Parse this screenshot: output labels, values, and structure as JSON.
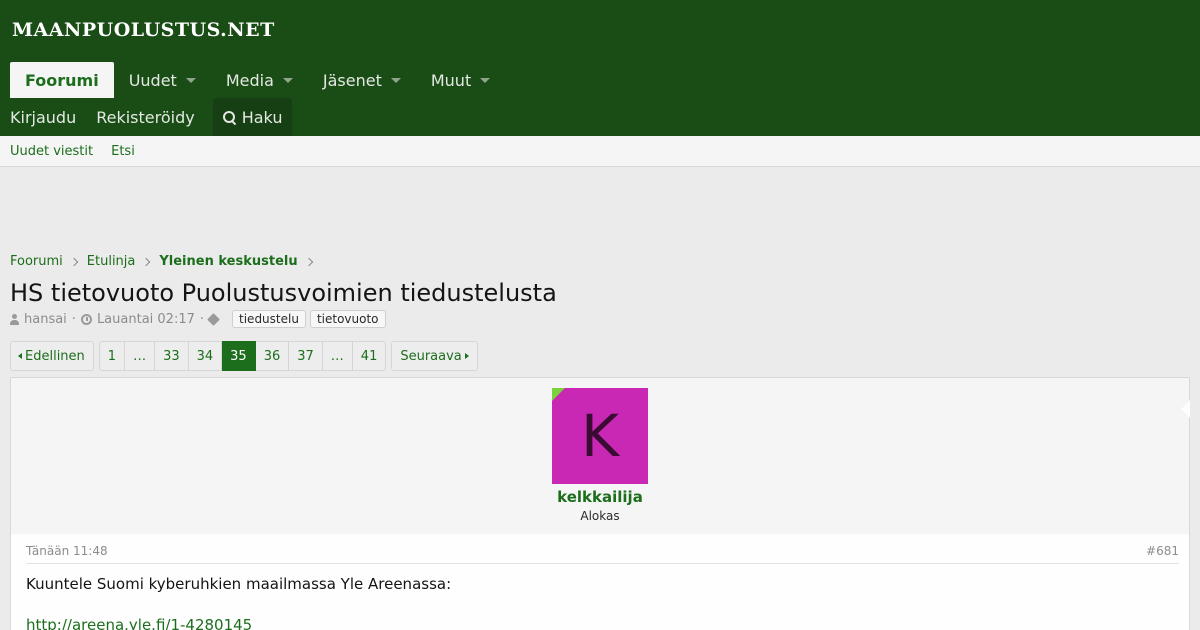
{
  "site": {
    "logo": "MAANPUOLUSTUS.NET"
  },
  "nav": {
    "items": [
      {
        "label": "Foorumi",
        "active": true
      },
      {
        "label": "Uudet",
        "dropdown": true
      },
      {
        "label": "Media",
        "dropdown": true
      },
      {
        "label": "Jäsenet",
        "dropdown": true
      },
      {
        "label": "Muut",
        "dropdown": true
      }
    ]
  },
  "userbar": {
    "login": "Kirjaudu",
    "register": "Rekisteröidy",
    "search": "Haku"
  },
  "subnav": {
    "new_posts": "Uudet viestit",
    "find": "Etsi"
  },
  "breadcrumb": {
    "items": [
      "Foorumi",
      "Etulinja",
      "Yleinen keskustelu"
    ]
  },
  "thread": {
    "title": "HS tietovuoto Puolustusvoimien tiedustelusta",
    "author": "hansai",
    "date": "Lauantai 02:17",
    "tags": [
      "tiedustelu",
      "tietovuoto"
    ]
  },
  "pagination": {
    "prev": "Edellinen",
    "next": "Seuraava",
    "pages": [
      "1",
      "…",
      "33",
      "34",
      "35",
      "36",
      "37",
      "…",
      "41"
    ],
    "current": "35"
  },
  "post": {
    "avatar_letter": "K",
    "username": "kelkkailija",
    "user_title": "Alokas",
    "date": "Tänään 11:48",
    "number": "#681",
    "text": "Kuuntele Suomi kyberuhkien maailmassa Yle Areenassa:",
    "link": "http://areena.yle.fi/1-4280145"
  },
  "colors": {
    "header": "#1a4d16",
    "accent": "#1c6e1c",
    "avatar": "#c928b4",
    "online": "#7ccf3d"
  }
}
